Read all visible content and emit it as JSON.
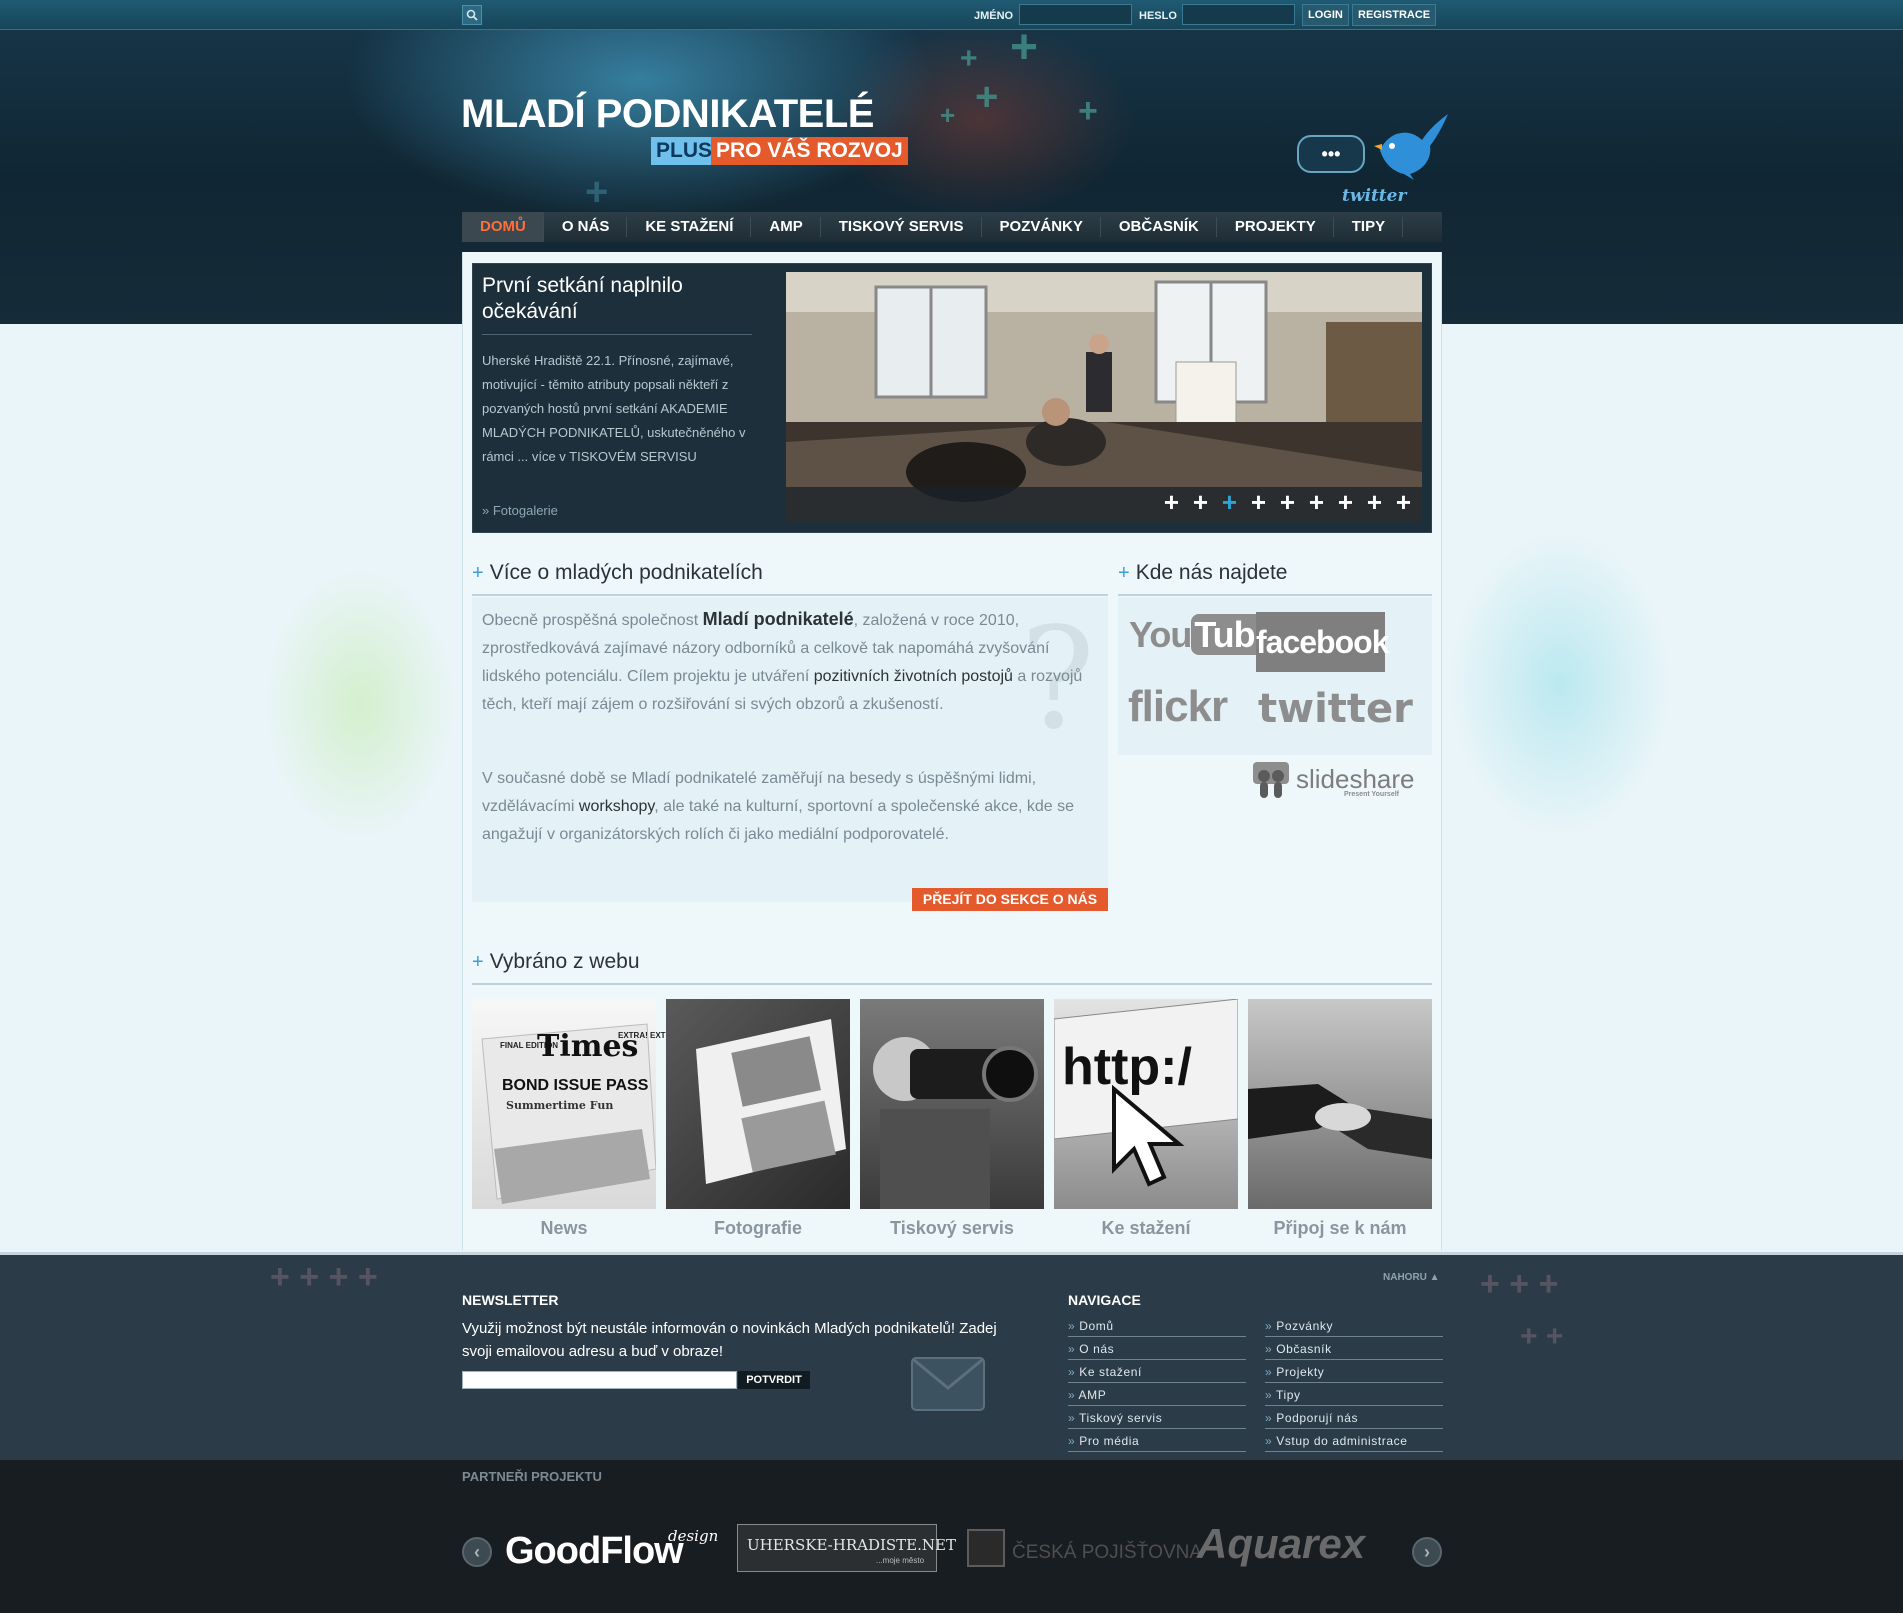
{
  "topbar": {
    "search_icon": "search-icon",
    "name_label": "JMÉNO",
    "password_label": "HESLO",
    "name_value": "",
    "password_value": "",
    "login_label": "LOGIN",
    "register_label": "REGISTRACE"
  },
  "logo": {
    "title": "MLADÍ PODNIKATELÉ",
    "plus": "PLUS",
    "tagline": "PRO VÁŠ ROZVOJ"
  },
  "twitter_badge": {
    "bubble": "•••",
    "label": "twitter"
  },
  "nav": {
    "items": [
      {
        "label": "DOMŮ",
        "active": true
      },
      {
        "label": "O NÁS"
      },
      {
        "label": "KE STAŽENÍ"
      },
      {
        "label": "AMP"
      },
      {
        "label": "TISKOVÝ SERVIS"
      },
      {
        "label": "POZVÁNKY"
      },
      {
        "label": "OBČASNÍK"
      },
      {
        "label": "PROJEKTY"
      },
      {
        "label": "TIPY"
      }
    ]
  },
  "slider": {
    "title": "První setkání naplnilo očekávání",
    "text": "Uherské Hradiště 22.1. Přínosné, zajímavé, motivující - těmito atributy popsali někteří z pozvaných hostů první setkání AKADEMIE MLADÝCH PODNIKATELŮ, uskutečněného v rámci ... více v TISKOVÉM SERVISU",
    "link": "» Fotogalerie",
    "dots": [
      "+",
      "+",
      "+",
      "+",
      "+",
      "+",
      "+",
      "+",
      "+"
    ],
    "active_dot": 2
  },
  "about": {
    "heading": "Více o mladých podnikatelích",
    "p1_a": "Obecně prospěšná společnost ",
    "p1_b": "Mladí podnikatelé",
    "p1_c": ", založená v roce 2010, zprostředkovává zajímavé názory odborníků a celkově tak napomáhá zvyšování lidského potenciálu. Cílem projektu je utváření ",
    "p1_d": "pozitivních životních postojů",
    "p1_e": " a rozvojů těch, kteří mají zájem o rozšiřování si svých obzorů a zkušeností.",
    "p2_a": "V současné době se Mladí podnikatelé zaměřují na besedy s úspěšnými lidmi, vzdělávacími ",
    "p2_b": "workshopy",
    "p2_c": ", ale také na kulturní, sportovní a společenské akce, kde se angažují v organizátorských rolích či jako mediální podporovatelé.",
    "button": "PŘEJÍT DO SEKCE O NÁS"
  },
  "find_us": {
    "heading": "Kde nás najdete",
    "youtube_a": "You",
    "youtube_b": "Tube",
    "facebook": "facebook",
    "flickr": "flickr",
    "twitter": "twitter",
    "slideshare": "slideshare",
    "slideshare_sub": "Present Yourself"
  },
  "gallery": {
    "heading": "Vybráno z webu",
    "items": [
      {
        "caption": "News",
        "img_text_1": "FINAL EDITION",
        "img_text_2": "Times",
        "img_text_3": "EXTRA! EXTRA!",
        "img_text_4": "BOND ISSUE PASS",
        "img_text_5": "Summertime Fun"
      },
      {
        "caption": "Fotografie"
      },
      {
        "caption": "Tiskový servis"
      },
      {
        "caption": "Ke stažení",
        "img_text": "http:/"
      },
      {
        "caption": "Připoj se k nám"
      }
    ]
  },
  "footer": {
    "nahoru": "NAHORU ▲",
    "newsletter_head": "NEWSLETTER",
    "newsletter_text": "Využij možnost být neustále informován o novinkách Mladých podnikatelů! Zadej svoji emailovou adresu a buď v obraze!",
    "newsletter_value": "",
    "newsletter_button": "POTVRDIT",
    "nav_head": "NAVIGACE",
    "nav_col1": [
      "Domů",
      "O nás",
      "Ke stažení",
      "AMP",
      "Tiskový servis",
      "Pro média"
    ],
    "nav_col2": [
      "Pozvánky",
      "Občasník",
      "Projekty",
      "Tipy",
      "Podporují nás",
      "Vstup do administrace"
    ]
  },
  "partners": {
    "heading": "PARTNEŘI PROJEKTU",
    "goodflow": "GoodFlow",
    "goodflow_sub": "design",
    "uh": "UHERSKE-HRADISTE.NET",
    "uh_sub": "...moje město",
    "cp": "ČESKÁ POJIŠŤOVNA",
    "aquarex": "Aquarex",
    "prev": "‹",
    "next": "›"
  },
  "colors": {
    "accent_orange": "#e45a2c",
    "nav_active": "#ff6f3c",
    "plus_blue": "#3aa0d4"
  }
}
